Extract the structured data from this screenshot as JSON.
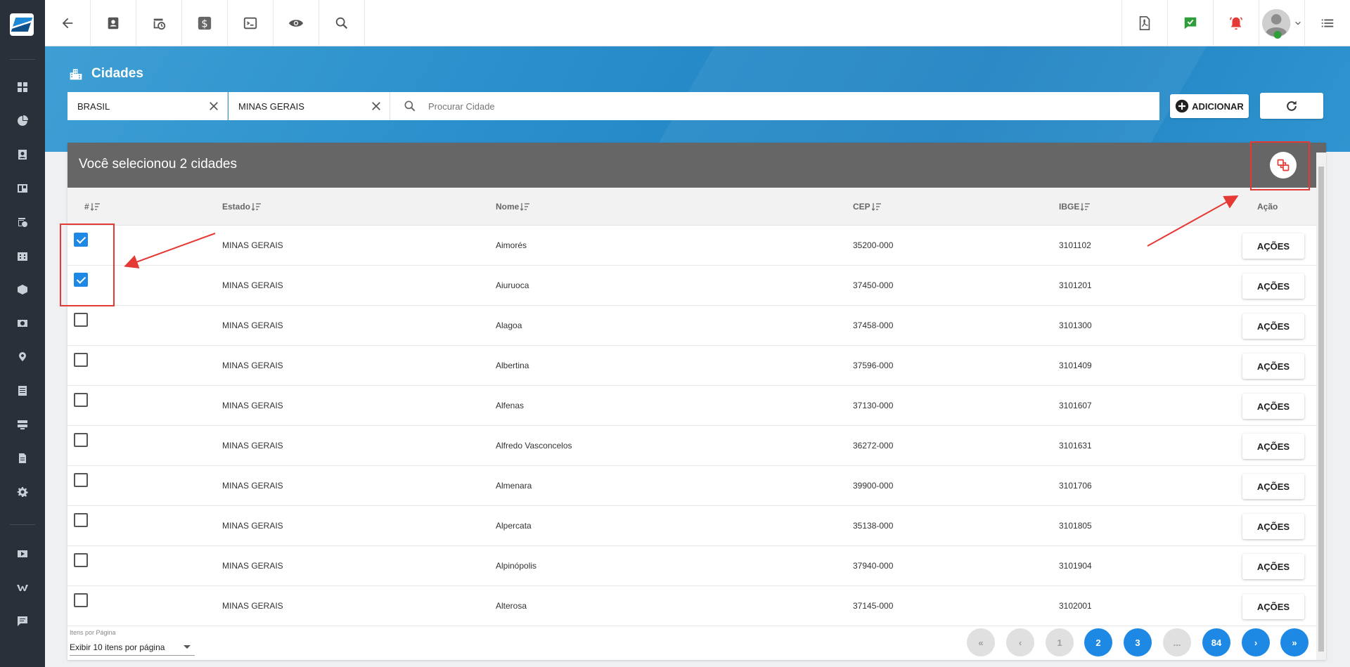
{
  "page": {
    "title": "Cidades"
  },
  "filters": {
    "country": "BRASIL",
    "state": "MINAS GERAIS",
    "search_placeholder": "Procurar Cidade"
  },
  "toolbar": {
    "add_label": "ADICIONAR"
  },
  "selection": {
    "text": "Você selecionou 2 cidades"
  },
  "table": {
    "columns": {
      "index": "#",
      "estado": "Estado",
      "nome": "Nome",
      "cep": "CEP",
      "ibge": "IBGE",
      "acao": "Ação"
    },
    "action_label": "AÇÕES",
    "rows": [
      {
        "checked": true,
        "estado": "MINAS GERAIS",
        "nome": "Aimorés",
        "cep": "35200-000",
        "ibge": "3101102"
      },
      {
        "checked": true,
        "estado": "MINAS GERAIS",
        "nome": "Aiuruoca",
        "cep": "37450-000",
        "ibge": "3101201"
      },
      {
        "checked": false,
        "estado": "MINAS GERAIS",
        "nome": "Alagoa",
        "cep": "37458-000",
        "ibge": "3101300"
      },
      {
        "checked": false,
        "estado": "MINAS GERAIS",
        "nome": "Albertina",
        "cep": "37596-000",
        "ibge": "3101409"
      },
      {
        "checked": false,
        "estado": "MINAS GERAIS",
        "nome": "Alfenas",
        "cep": "37130-000",
        "ibge": "3101607"
      },
      {
        "checked": false,
        "estado": "MINAS GERAIS",
        "nome": "Alfredo Vasconcelos",
        "cep": "36272-000",
        "ibge": "3101631"
      },
      {
        "checked": false,
        "estado": "MINAS GERAIS",
        "nome": "Almenara",
        "cep": "39900-000",
        "ibge": "3101706"
      },
      {
        "checked": false,
        "estado": "MINAS GERAIS",
        "nome": "Alpercata",
        "cep": "35138-000",
        "ibge": "3101805"
      },
      {
        "checked": false,
        "estado": "MINAS GERAIS",
        "nome": "Alpinópolis",
        "cep": "37940-000",
        "ibge": "3101904"
      },
      {
        "checked": false,
        "estado": "MINAS GERAIS",
        "nome": "Alterosa",
        "cep": "37145-000",
        "ibge": "3102001"
      }
    ]
  },
  "pagination": {
    "per_page_label": "Itens por Página",
    "per_page_value": "Exibir 10 itens por página",
    "first": "«",
    "prev": "‹",
    "pages": [
      "1",
      "2",
      "3",
      "...",
      "84"
    ],
    "current_page": "1",
    "next": "›",
    "last": "»"
  },
  "colors": {
    "accent": "#1e88e5",
    "header_blue": "#2a8fcb",
    "selection_bar": "#666666",
    "annotation": "#e53935",
    "sidebar": "#2a3039"
  },
  "icons": {
    "sidebar": [
      "dashboard-icon",
      "pie-chart-icon",
      "contact-card-icon",
      "board-icon",
      "calendar-clock-icon",
      "building-icon",
      "box-icon",
      "money-icon",
      "map-pin-icon",
      "list-icon",
      "server-icon",
      "document-icon",
      "gear-icon",
      "video-icon",
      "wiki-icon",
      "chat-icon"
    ],
    "topbar_left": [
      "back-arrow-icon",
      "contact-card-icon",
      "calendar-clock-icon",
      "dollar-icon",
      "terminal-icon",
      "eye-icon",
      "search-icon"
    ],
    "topbar_right": [
      "pdf-icon",
      "check-message-icon",
      "alarm-bell-icon",
      "avatar",
      "menu-list-icon"
    ]
  }
}
